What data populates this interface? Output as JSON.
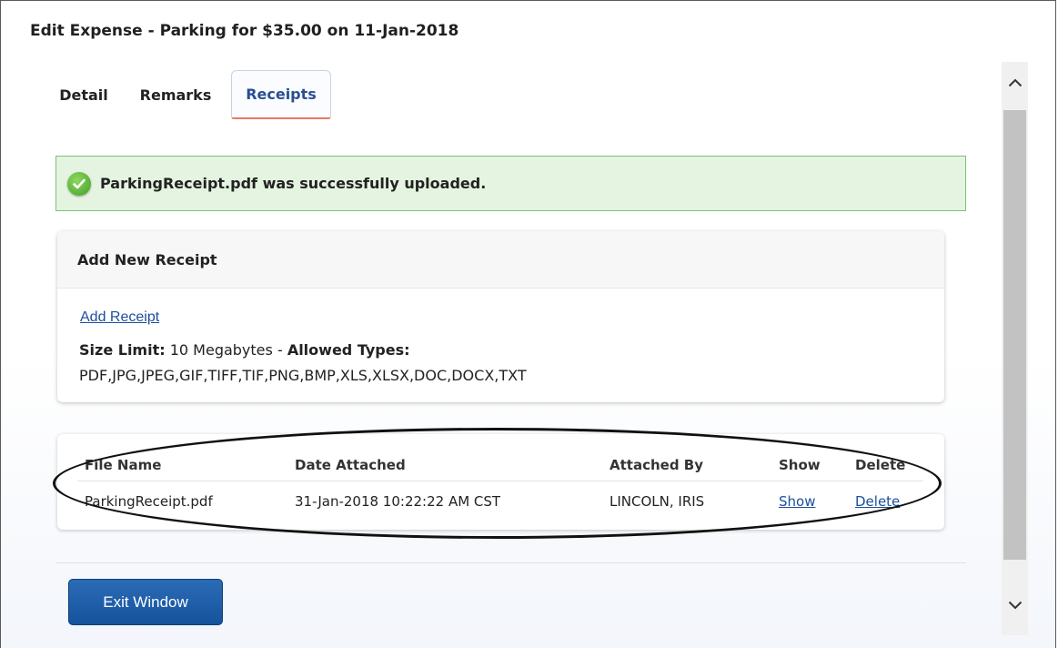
{
  "window": {
    "title": "Edit Expense - Parking for $35.00 on 11-Jan-2018"
  },
  "tabs": [
    {
      "label": "Detail"
    },
    {
      "label": "Remarks"
    },
    {
      "label": "Receipts"
    }
  ],
  "alert": {
    "message": "ParkingReceipt.pdf was successfully uploaded."
  },
  "add_receipt": {
    "header": "Add New Receipt",
    "link": "Add Receipt",
    "size_label": "Size Limit:",
    "size_value": "10 Megabytes",
    "separator": " - ",
    "types_label": "Allowed Types:",
    "types_value": "PDF,JPG,JPEG,GIF,TIFF,TIF,PNG,BMP,XLS,XLSX,DOC,DOCX,TXT"
  },
  "receipts_table": {
    "headers": [
      "File Name",
      "Date Attached",
      "Attached By",
      "Show",
      "Delete"
    ],
    "rows": [
      {
        "file_name": "ParkingReceipt.pdf",
        "date_attached": "31-Jan-2018 10:22:22 AM CST",
        "attached_by": "LINCOLN, IRIS",
        "show": "Show",
        "delete": "Delete"
      }
    ]
  },
  "footer": {
    "exit_button": "Exit Window"
  },
  "colors": {
    "accent_blue": "#15539c",
    "success_green": "#7cc07a",
    "tab_underline": "#e9795b",
    "link": "#1c4f9c"
  },
  "icons": [
    "check-circle-icon",
    "chevron-up-icon",
    "chevron-down-icon"
  ]
}
